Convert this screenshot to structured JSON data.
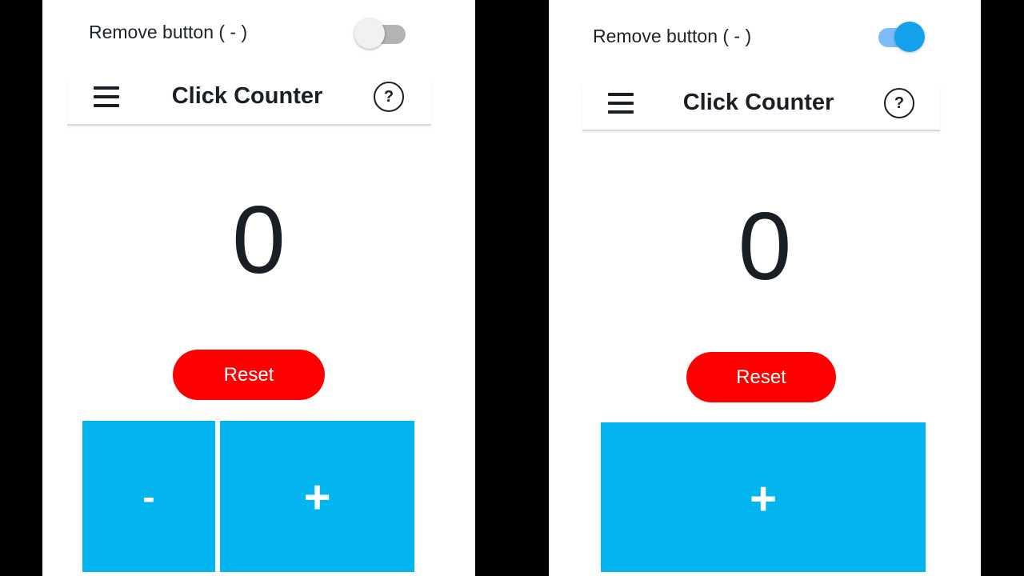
{
  "colors": {
    "background": "#000000",
    "panel": "#ffffff",
    "text": "#1a1f26",
    "reset_button": "#ff0000",
    "counter_buttons": "#03b5ef",
    "toggle_on": "#12a3ec",
    "toggle_off": "#b3b3b3"
  },
  "left": {
    "toggle_label": "Remove button ( - )",
    "toggle_on": false,
    "title": "Click Counter",
    "help_glyph": "?",
    "count": "0",
    "reset_label": "Reset",
    "minus_label": "-",
    "plus_label": "+"
  },
  "right": {
    "toggle_label": "Remove button ( - )",
    "toggle_on": true,
    "title": "Click Counter",
    "help_glyph": "?",
    "count": "0",
    "reset_label": "Reset",
    "plus_label": "+"
  },
  "icons": {
    "menu": "hamburger-menu-icon",
    "help": "help-icon"
  }
}
